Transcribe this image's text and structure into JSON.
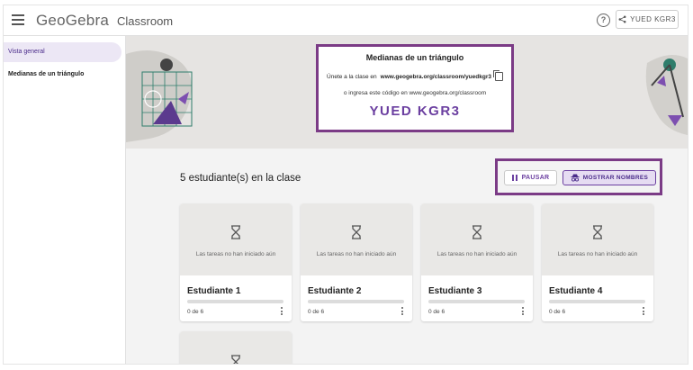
{
  "header": {
    "logo": "GeoGebra",
    "product": "Classroom",
    "class_code_button": "YUED KGR3",
    "help_glyph": "?"
  },
  "sidebar": {
    "items": [
      {
        "label": "Vista general",
        "active": true
      },
      {
        "label": "Medianas de un triángulo",
        "active": false
      }
    ]
  },
  "banner": {
    "title": "Medianas de un triángulo",
    "join_prefix": "Únete a la clase en",
    "join_url": "www.geogebra.org/classroom/yuedkgr3",
    "alt_text": "o ingresa este código en www.geogebra.org/classroom",
    "code": "YUED KGR3"
  },
  "main": {
    "student_count_label": "5 estudiante(s) en la clase",
    "pause_label": "PAUSAR",
    "show_names_label": "MOSTRAR NOMBRES"
  },
  "students": [
    {
      "name": "Estudiante 1",
      "status": "Las tareas no han iniciado aún",
      "progress_text": "0 de 6",
      "progress": 0
    },
    {
      "name": "Estudiante 2",
      "status": "Las tareas no han iniciado aún",
      "progress_text": "0 de 6",
      "progress": 0
    },
    {
      "name": "Estudiante 3",
      "status": "Las tareas no han iniciado aún",
      "progress_text": "0 de 6",
      "progress": 0
    },
    {
      "name": "Estudiante 4",
      "status": "Las tareas no han iniciado aún",
      "progress_text": "0 de 6",
      "progress": 0
    }
  ],
  "colors": {
    "accent": "#6b3fa0",
    "highlight_border": "#7b3b86",
    "banner_bg": "#e6e4e2",
    "main_bg": "#f3f3f3"
  }
}
